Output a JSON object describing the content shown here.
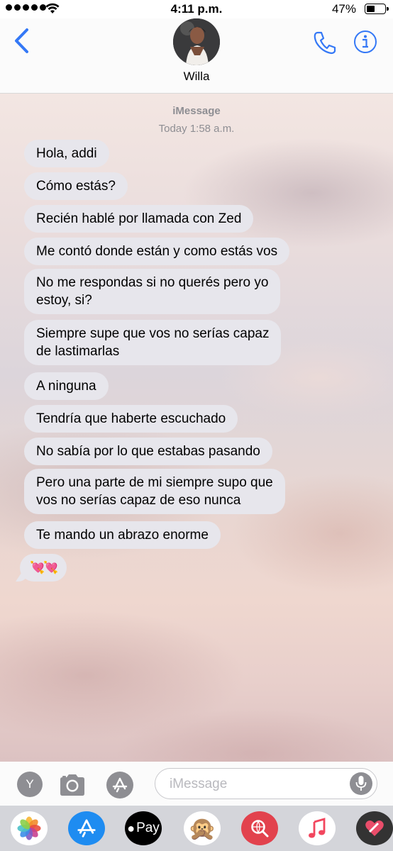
{
  "status_bar": {
    "time": "4:11 p.m.",
    "battery": "47%",
    "battery_level": 0.47
  },
  "header": {
    "contact_name": "Willa",
    "back_icon": "chevron-left-icon",
    "call_icon": "phone-icon",
    "info_icon": "info-icon",
    "accent_color": "#3478f6"
  },
  "chat": {
    "service": "iMessage",
    "timestamp": "Today 1:58 a.m.",
    "messages": [
      {
        "text": "Hola, addi"
      },
      {
        "text": "Cómo estás?"
      },
      {
        "text": "Recién hablé por llamada con Zed"
      },
      {
        "text": "Me contó donde están y como estás vos"
      },
      {
        "text": "No me respondas si no querés pero yo\nestoy, si?"
      },
      {
        "text": "Siempre supe que vos no serías capaz\nde lastimarlas"
      },
      {
        "text": "A ninguna"
      },
      {
        "text": "Tendría que haberte escuchado"
      },
      {
        "text": "No sabía por lo que estabas pasando"
      },
      {
        "text": "Pero una parte de mi siempre supo que\nvos no serías capaz de eso nunca"
      },
      {
        "text": "Te mando un abrazo enorme"
      },
      {
        "text": "💘💘"
      }
    ],
    "bubble_color": "#e7e6ec"
  },
  "input_bar": {
    "memoji_label": "Y",
    "placeholder": "iMessage"
  },
  "app_drawer": {
    "apps": [
      "photos-icon",
      "app-store-icon",
      "apple-pay-icon",
      "monkey-emoji-icon",
      "web-search-icon",
      "music-icon",
      "heart-sticker-icon"
    ],
    "apple_pay_label": "Pay",
    "monkey_emoji": "🙊"
  }
}
